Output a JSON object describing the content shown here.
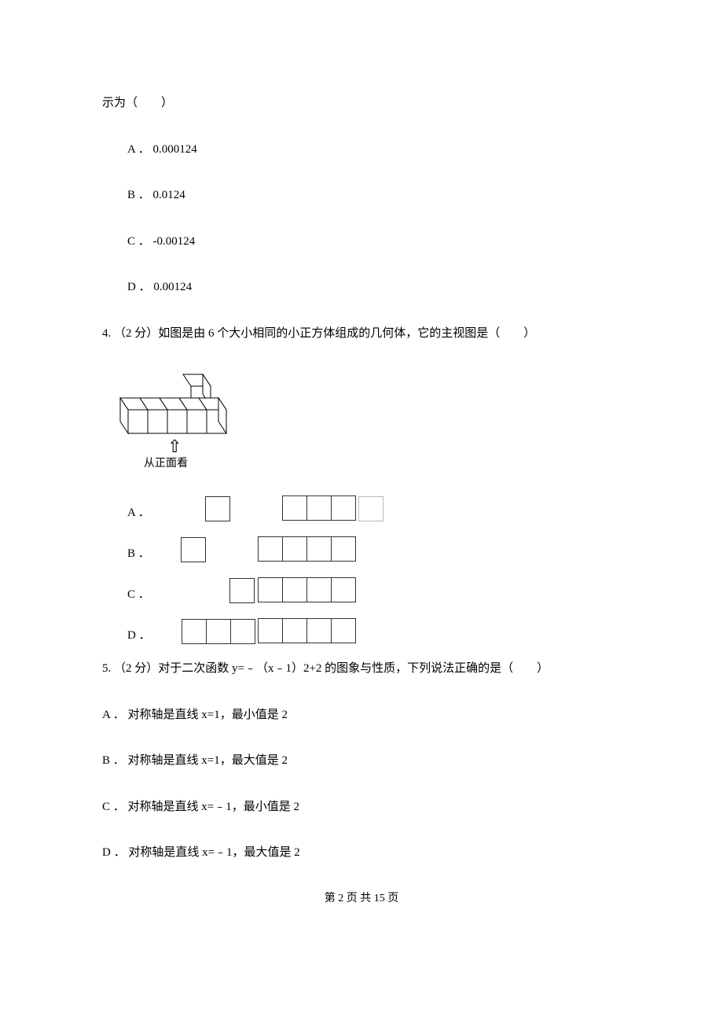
{
  "q3_fragment": "示为（　　）",
  "q3": {
    "A": "A ． 0.000124",
    "B": "B ． 0.0124",
    "C": "C ． -0.00124",
    "D": "D ． 0.00124"
  },
  "q4": {
    "stem": "4.  （2 分）如图是由 6 个大小相同的小正方体组成的几何体，它的主视图是（　　）",
    "caption": "从正面看",
    "A": "A ．",
    "B": "B ．",
    "C": "C ．",
    "D": "D ．"
  },
  "q5": {
    "stem": "5.  （2 分）对于二次函数 y=﹣（x﹣1）2+2 的图象与性质，下列说法正确的是（　　）",
    "A": "A ． 对称轴是直线 x=1，最小值是 2",
    "B": "B ． 对称轴是直线 x=1，最大值是 2",
    "C": "C ． 对称轴是直线 x=﹣1，最小值是 2",
    "D": "D ． 对称轴是直线 x=﹣1，最大值是 2"
  },
  "footer": "第 2 页 共 15 页"
}
